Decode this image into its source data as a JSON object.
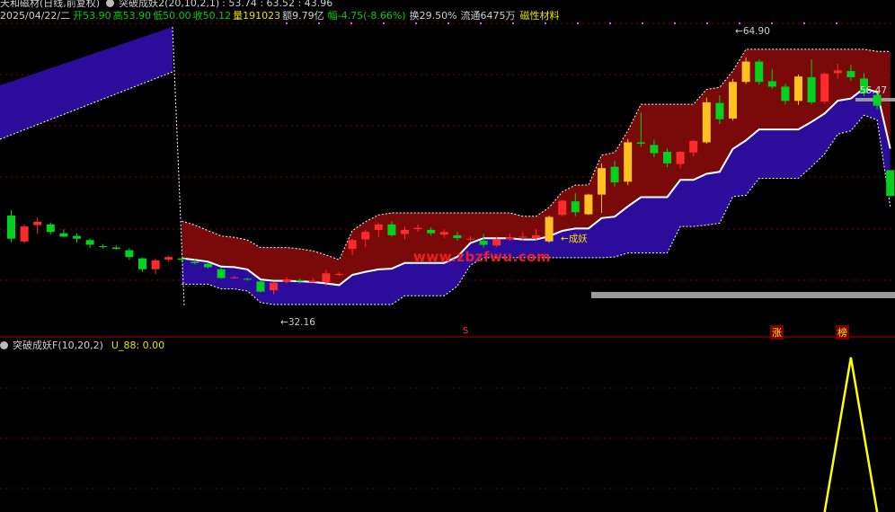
{
  "header": {
    "stock_name": "天和磁材(日线,前复权)",
    "indicator_title": "突破成妖2(20,10,2,1)",
    "indicator_values": ": 53.74 : 63.52 : 43.96",
    "date": "2025/04/22/二",
    "open_label": "开",
    "open": "53.90",
    "high_label": "高",
    "high": "53.90",
    "low_label": "低",
    "low": "50.00",
    "close_label": "收",
    "close": "50.12",
    "volume_label": "量",
    "volume": "191023",
    "amount_label": "额",
    "amount": "9.79亿",
    "change_label": "幅",
    "change": "-4.75(-8.66%)",
    "turnover_label": "换",
    "turnover": "29.50%",
    "float_label": "流通",
    "float": "6475万",
    "sector": "磁性材料"
  },
  "sub_panel": {
    "title": "突破成妖F(10,20,2)",
    "value_text": "U_88: 0.00"
  },
  "annotations": {
    "high_mark": "64.90",
    "low_mark": "32.16",
    "price_tag": "56.47",
    "signal_text": "成妖",
    "watermark": "www.zbzfwu.com",
    "marker_s": "S",
    "marker_zhang": "涨",
    "marker_bang": "榜"
  },
  "colors": {
    "background": "#000000",
    "up_candle": "#ff2a2a",
    "down_candle": "#00d21e",
    "breakout_candle": "#ffc020",
    "upper_band": "#7a0a0a",
    "lower_band": "#2c0c9a",
    "signal_line": "#ffff00",
    "grid": "#7a0000"
  },
  "chart_data": [
    {
      "type": "candlestick",
      "y_range_estimated": [
        30,
        75
      ],
      "candles_ohlc": [
        [
          47.2,
          48.0,
          43.3,
          43.8
        ],
        [
          43.4,
          45.9,
          43.1,
          45.6
        ],
        [
          45.8,
          46.9,
          44.5,
          46.3
        ],
        [
          45.9,
          46.2,
          44.4,
          44.8
        ],
        [
          44.6,
          45.2,
          44.0,
          44.1
        ],
        [
          44.2,
          44.6,
          43.2,
          43.8
        ],
        [
          43.6,
          43.8,
          42.4,
          42.9
        ],
        [
          42.7,
          43.0,
          42.3,
          42.6
        ],
        [
          42.5,
          42.8,
          42.2,
          42.3
        ],
        [
          42.1,
          42.4,
          40.7,
          41.1
        ],
        [
          40.9,
          41.0,
          38.9,
          39.3
        ],
        [
          39.3,
          40.8,
          38.6,
          40.6
        ],
        [
          40.7,
          41.3,
          40.4,
          41.1
        ],
        [
          40.9,
          41.1,
          40.4,
          40.7
        ],
        [
          40.4,
          40.8,
          40.0,
          40.2
        ],
        [
          40.1,
          40.2,
          39.4,
          39.6
        ],
        [
          39.3,
          39.5,
          37.9,
          38.0
        ],
        [
          38.1,
          38.3,
          37.9,
          38.1
        ],
        [
          37.9,
          38.0,
          37.6,
          37.8
        ],
        [
          37.5,
          37.6,
          35.9,
          36.0
        ],
        [
          36.2,
          37.5,
          35.6,
          37.3
        ],
        [
          37.4,
          38.1,
          37.2,
          37.8
        ],
        [
          37.7,
          37.9,
          37.2,
          37.5
        ],
        [
          37.4,
          38.0,
          37.2,
          37.6
        ],
        [
          37.4,
          39.2,
          36.9,
          38.7
        ],
        [
          38.5,
          38.9,
          38.3,
          38.6
        ],
        [
          42.3,
          43.8,
          41.4,
          43.6
        ],
        [
          43.7,
          45.1,
          42.6,
          44.8
        ],
        [
          45.1,
          46.1,
          44.0,
          45.9
        ],
        [
          45.9,
          46.4,
          44.1,
          44.3
        ],
        [
          44.5,
          45.6,
          43.7,
          45.1
        ],
        [
          45.2,
          45.9,
          44.8,
          45.4
        ],
        [
          45.1,
          45.5,
          44.3,
          44.6
        ],
        [
          44.4,
          45.2,
          43.9,
          44.8
        ],
        [
          44.3,
          44.8,
          43.5,
          43.9
        ],
        [
          43.7,
          44.2,
          43.4,
          43.8
        ],
        [
          43.5,
          44.5,
          42.5,
          42.9
        ],
        [
          42.8,
          44.1,
          42.6,
          43.7
        ],
        [
          43.7,
          44.6,
          43.5,
          44.0
        ],
        [
          44.0,
          44.8,
          43.6,
          44.1
        ],
        [
          43.9,
          45.2,
          43.6,
          44.3
        ],
        [
          43.4,
          47.2,
          43.2,
          47.0
        ],
        [
          47.3,
          49.5,
          47.1,
          49.4
        ],
        [
          49.3,
          50.5,
          47.1,
          47.7
        ],
        [
          47.4,
          50.4,
          47.3,
          50.3
        ],
        [
          50.3,
          54.9,
          47.6,
          54.2
        ],
        [
          54.4,
          55.3,
          51.5,
          52.1
        ],
        [
          52.2,
          58.5,
          51.7,
          58.0
        ],
        [
          58.0,
          62.4,
          57.3,
          57.8
        ],
        [
          57.6,
          58.4,
          55.8,
          56.4
        ],
        [
          56.6,
          57.1,
          54.3,
          54.9
        ],
        [
          54.8,
          56.7,
          54.2,
          56.6
        ],
        [
          56.5,
          58.4,
          55.9,
          58.2
        ],
        [
          58.0,
          64.6,
          57.8,
          63.9
        ],
        [
          63.8,
          64.9,
          60.7,
          61.4
        ],
        [
          61.5,
          67.3,
          61.2,
          66.9
        ],
        [
          66.9,
          70.5,
          66.6,
          69.9
        ],
        [
          69.9,
          70.2,
          66.5,
          66.9
        ],
        [
          67.0,
          68.8,
          65.9,
          66.2
        ],
        [
          66.2,
          66.6,
          63.6,
          64.1
        ],
        [
          64.1,
          68.0,
          63.5,
          67.7
        ],
        [
          67.6,
          70.2,
          63.6,
          63.9
        ],
        [
          64.0,
          68.3,
          63.7,
          68.1
        ],
        [
          68.2,
          69.6,
          67.4,
          68.6
        ],
        [
          68.5,
          69.4,
          67.1,
          67.6
        ],
        [
          67.4,
          68.2,
          64.8,
          65.2
        ],
        [
          65.0,
          65.3,
          62.8,
          63.4
        ],
        [
          53.9,
          53.9,
          50.0,
          50.1
        ]
      ]
    },
    {
      "type": "line",
      "name": "U_88",
      "x_index": [
        62,
        64,
        66
      ],
      "values": [
        0,
        1,
        0
      ]
    }
  ]
}
